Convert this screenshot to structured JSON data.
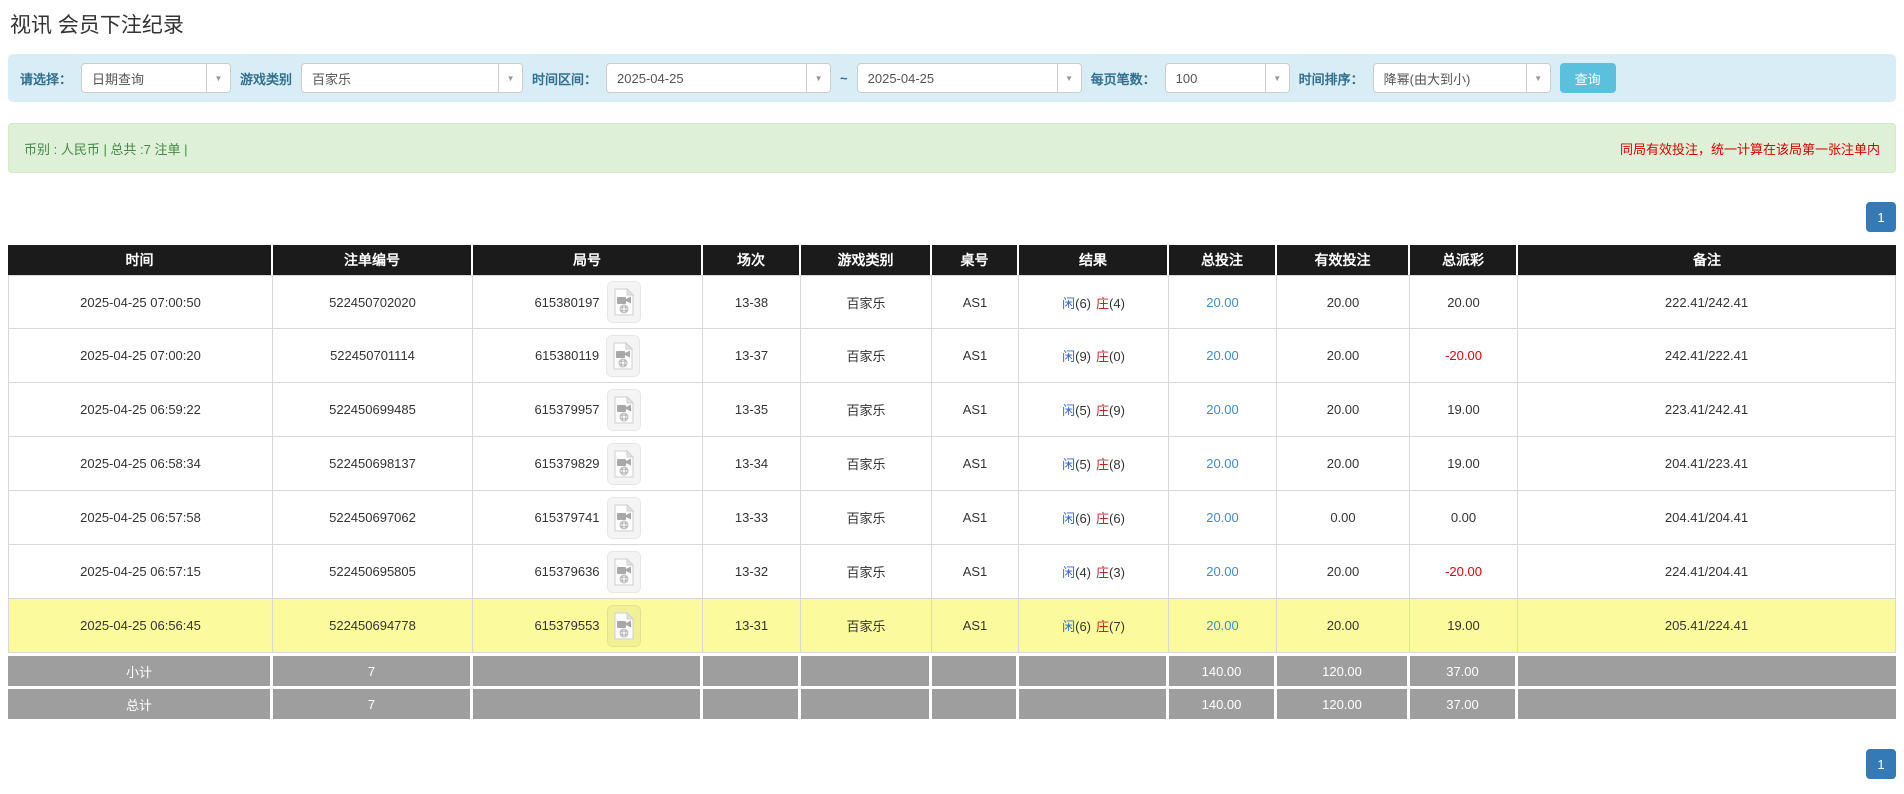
{
  "page": {
    "title": "视讯 会员下注纪录"
  },
  "filters": {
    "select_label": "请选择：",
    "select_value": "日期查询",
    "game_type_label": "游戏类别",
    "game_type_value": "百家乐",
    "time_range_label": "时间区间：",
    "date_from": "2025-04-25",
    "tilde": "~",
    "date_to": "2025-04-25",
    "page_size_label": "每页笔数：",
    "page_size_value": "100",
    "sort_label": "时间排序：",
    "sort_value": "降幂(由大到小)",
    "search_button": "查询"
  },
  "summary": {
    "left": "币别 : 人民币 | 总共 :7 注单 |",
    "right_notice": "同局有效投注，统一计算在该局第一张注单内"
  },
  "pagination": {
    "page": "1"
  },
  "table": {
    "headers": [
      "时间",
      "注单编号",
      "局号",
      "场次",
      "游戏类别",
      "桌号",
      "结果",
      "总投注",
      "有效投注",
      "总派彩",
      "备注"
    ],
    "rows": [
      {
        "time": "2025-04-25 07:00:50",
        "bet_id": "522450702020",
        "round_id": "615380197",
        "session": "13-38",
        "game": "百家乐",
        "table_no": "AS1",
        "result_p_label": "闲",
        "result_p_score": "(6)",
        "result_b_label": "庄",
        "result_b_score": "(4)",
        "total_bet": "20.00",
        "valid_bet": "20.00",
        "payout": "20.00",
        "note": "222.41/242.41",
        "highlight": false
      },
      {
        "time": "2025-04-25 07:00:20",
        "bet_id": "522450701114",
        "round_id": "615380119",
        "session": "13-37",
        "game": "百家乐",
        "table_no": "AS1",
        "result_p_label": "闲",
        "result_p_score": "(9)",
        "result_b_label": "庄",
        "result_b_score": "(0)",
        "total_bet": "20.00",
        "valid_bet": "20.00",
        "payout": "-20.00",
        "note": "242.41/222.41",
        "highlight": false
      },
      {
        "time": "2025-04-25 06:59:22",
        "bet_id": "522450699485",
        "round_id": "615379957",
        "session": "13-35",
        "game": "百家乐",
        "table_no": "AS1",
        "result_p_label": "闲",
        "result_p_score": "(5)",
        "result_b_label": "庄",
        "result_b_score": "(9)",
        "total_bet": "20.00",
        "valid_bet": "20.00",
        "payout": "19.00",
        "note": "223.41/242.41",
        "highlight": false
      },
      {
        "time": "2025-04-25 06:58:34",
        "bet_id": "522450698137",
        "round_id": "615379829",
        "session": "13-34",
        "game": "百家乐",
        "table_no": "AS1",
        "result_p_label": "闲",
        "result_p_score": "(5)",
        "result_b_label": "庄",
        "result_b_score": "(8)",
        "total_bet": "20.00",
        "valid_bet": "20.00",
        "payout": "19.00",
        "note": "204.41/223.41",
        "highlight": false
      },
      {
        "time": "2025-04-25 06:57:58",
        "bet_id": "522450697062",
        "round_id": "615379741",
        "session": "13-33",
        "game": "百家乐",
        "table_no": "AS1",
        "result_p_label": "闲",
        "result_p_score": "(6)",
        "result_b_label": "庄",
        "result_b_score": "(6)",
        "total_bet": "20.00",
        "valid_bet": "0.00",
        "payout": "0.00",
        "note": "204.41/204.41",
        "highlight": false
      },
      {
        "time": "2025-04-25 06:57:15",
        "bet_id": "522450695805",
        "round_id": "615379636",
        "session": "13-32",
        "game": "百家乐",
        "table_no": "AS1",
        "result_p_label": "闲",
        "result_p_score": "(4)",
        "result_b_label": "庄",
        "result_b_score": "(3)",
        "total_bet": "20.00",
        "valid_bet": "20.00",
        "payout": "-20.00",
        "note": "224.41/204.41",
        "highlight": false
      },
      {
        "time": "2025-04-25 06:56:45",
        "bet_id": "522450694778",
        "round_id": "615379553",
        "session": "13-31",
        "game": "百家乐",
        "table_no": "AS1",
        "result_p_label": "闲",
        "result_p_score": "(6)",
        "result_b_label": "庄",
        "result_b_score": "(7)",
        "total_bet": "20.00",
        "valid_bet": "20.00",
        "payout": "19.00",
        "note": "205.41/224.41",
        "highlight": true
      }
    ],
    "footer": [
      {
        "label": "小计",
        "count": "7",
        "total_bet": "140.00",
        "valid_bet": "120.00",
        "payout": "37.00"
      },
      {
        "label": "总计",
        "count": "7",
        "total_bet": "140.00",
        "valid_bet": "120.00",
        "payout": "37.00"
      }
    ]
  },
  "colors": {
    "accent": "#5bc0de",
    "pagination": "#337ab7",
    "header-bg": "#1b1b1b",
    "highlight": "#fbfb9e",
    "footer-bg": "#9e9e9e",
    "link": "#428bca",
    "negative": "#ee0000",
    "player-blue": "#3366cc",
    "banker-red": "#cc2222",
    "info-bg": "#d9edf7",
    "info-text": "#31708f",
    "success-bg": "#dff0d8",
    "success-text": "#468847",
    "notice-red": "#dd0000"
  }
}
